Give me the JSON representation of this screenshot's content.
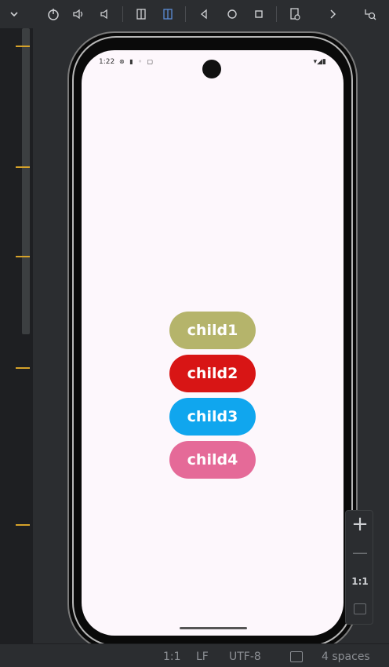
{
  "status_bar": {
    "time": "1:22",
    "left_icons": "⊗ ▮ ◦ ▢",
    "right_icons": "▾◢▮"
  },
  "items": [
    {
      "label": "child1",
      "color": "#b5b46b"
    },
    {
      "label": "child2",
      "color": "#d81515"
    },
    {
      "label": "child3",
      "color": "#10a6ee"
    },
    {
      "label": "child4",
      "color": "#e56a98"
    }
  ],
  "zoom": {
    "plus": "+",
    "minus": "—",
    "actual_size": "1:1"
  },
  "bottom_bar": {
    "position": "1:1",
    "line_ending": "LF",
    "encoding": "UTF-8",
    "indent": "4 spaces"
  },
  "accent": {
    "ruler_tick": "#d6a22a",
    "screen_bg": "#fdf7fc"
  }
}
